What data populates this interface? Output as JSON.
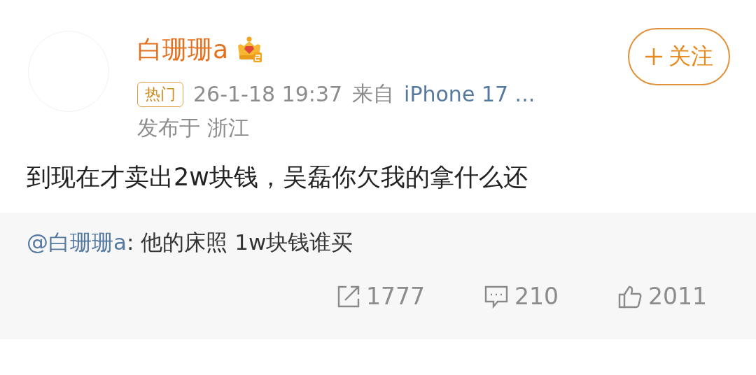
{
  "author": {
    "name": "白珊珊a",
    "follow_button": "关注"
  },
  "meta": {
    "tag": "热门",
    "time": "26-1-18 19:37",
    "source_prefix": "来自",
    "source": "iPhone 17 ...",
    "location": "发布于 浙江"
  },
  "post": {
    "text": "到现在才卖出2w块钱，吴磊你欠我的拿什么还"
  },
  "repost": {
    "mention": "@白珊珊a",
    "text": ": 他的床照 1w块钱谁买"
  },
  "actions": [
    {
      "kind": "share",
      "count": "1777"
    },
    {
      "kind": "comment",
      "count": "210"
    },
    {
      "kind": "like",
      "count": "2011"
    }
  ]
}
